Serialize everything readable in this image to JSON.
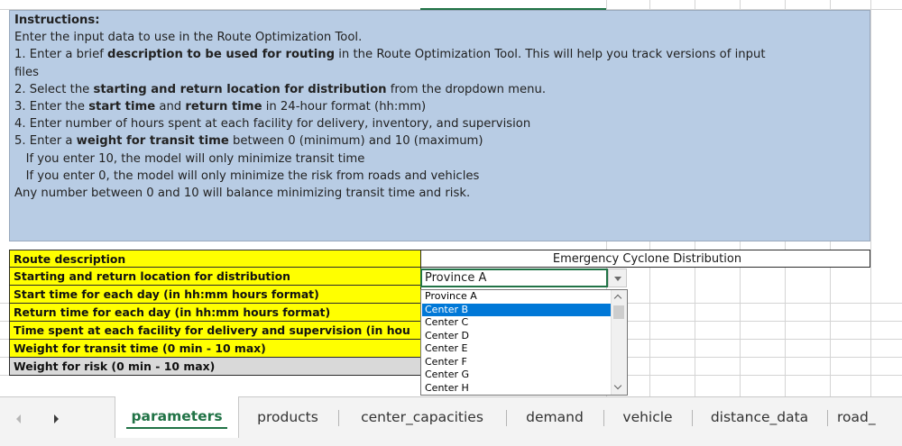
{
  "instructions": {
    "heading": "Instructions:",
    "intro": "Enter the input data to use in the Route Optimization Tool.",
    "steps": [
      {
        "pre": "1. Enter a brief ",
        "bold": "description to be used for routing",
        "post": " in the Route Optimization Tool. This will help you track versions of input"
      },
      {
        "pre": "files",
        "bold": "",
        "post": ""
      },
      {
        "pre": "2. Select the ",
        "bold": "starting and return location for  distribution",
        "post": " from the dropdown menu."
      },
      {
        "pre": "3. Enter the ",
        "bold": "start time",
        "mid": " and ",
        "bold2": "return time",
        "post": " in 24-hour format (hh:mm)"
      },
      {
        "pre": "4. Enter number of hours spent at each facility for delivery, inventory, and supervision",
        "bold": "",
        "post": ""
      },
      {
        "pre": "5. Enter a ",
        "bold": "weight for transit time",
        "post": " between 0 (minimum) and 10 (maximum)"
      },
      {
        "pre": "   If you enter 10, the model will only minimize transit time",
        "bold": "",
        "post": ""
      },
      {
        "pre": "   If you enter 0, the model will only minimize the risk from roads and vehicles",
        "bold": "",
        "post": ""
      },
      {
        "pre": "Any number between 0 and 10 will balance minimizing transit time and risk.",
        "bold": "",
        "post": ""
      }
    ]
  },
  "params": {
    "route_description_label": "Route description",
    "route_description_value": "Emergency Cyclone Distribution",
    "starting_location_label": "Starting and return location for distribution",
    "starting_location_value": "Province A",
    "start_time_label": "Start time for each day (in hh:mm hours format)",
    "return_time_label": "Return time for each day (in hh:mm hours format)",
    "time_spent_label": "Time spent at each facility for delivery and supervision (in hou",
    "transit_weight_label": "Weight for transit time (0 min - 10 max)",
    "risk_weight_label": "Weight for risk (0 min - 10 max)"
  },
  "dropdown": {
    "options": [
      "Province A",
      "Center B",
      "Center C",
      "Center D",
      "Center E",
      "Center F",
      "Center G",
      "Center H"
    ],
    "highlighted": "Center B"
  },
  "tabs": {
    "items": [
      "parameters",
      "products",
      "center_capacities",
      "demand",
      "vehicle",
      "distance_data",
      "road_"
    ],
    "active": "parameters"
  },
  "colors": {
    "instructions_bg": "#b8cce4",
    "label_yellow": "#ffff00",
    "label_gray": "#d9d9d9",
    "selection_blue": "#0078d7",
    "excel_green": "#217346"
  },
  "icons": {
    "dropdown_arrow": "chevron-down-icon",
    "sheet_nav_left": "caret-left-icon",
    "sheet_nav_right": "caret-right-icon"
  }
}
